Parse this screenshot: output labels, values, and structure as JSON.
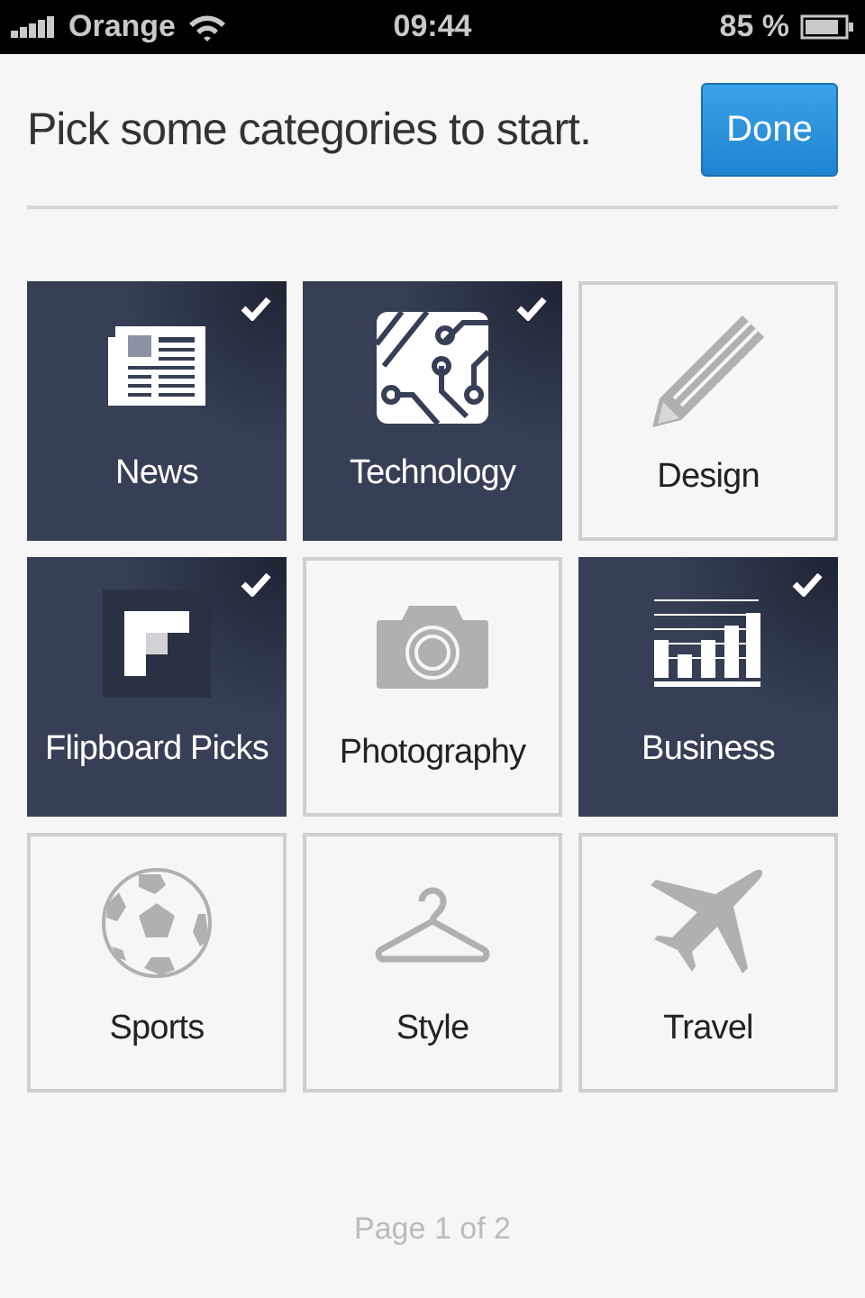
{
  "status_bar": {
    "carrier": "Orange",
    "time": "09:44",
    "battery": "85 %"
  },
  "header": {
    "title": "Pick some categories to start.",
    "button": "Done"
  },
  "tiles": [
    {
      "label": "News",
      "selected": true
    },
    {
      "label": "Technology",
      "selected": true
    },
    {
      "label": "Design",
      "selected": false
    },
    {
      "label": "Flipboard Picks",
      "selected": true
    },
    {
      "label": "Photography",
      "selected": false
    },
    {
      "label": "Business",
      "selected": true
    },
    {
      "label": "Sports",
      "selected": false
    },
    {
      "label": "Style",
      "selected": false
    },
    {
      "label": "Travel",
      "selected": false
    }
  ],
  "footer": {
    "page": "Page 1 of 2"
  }
}
